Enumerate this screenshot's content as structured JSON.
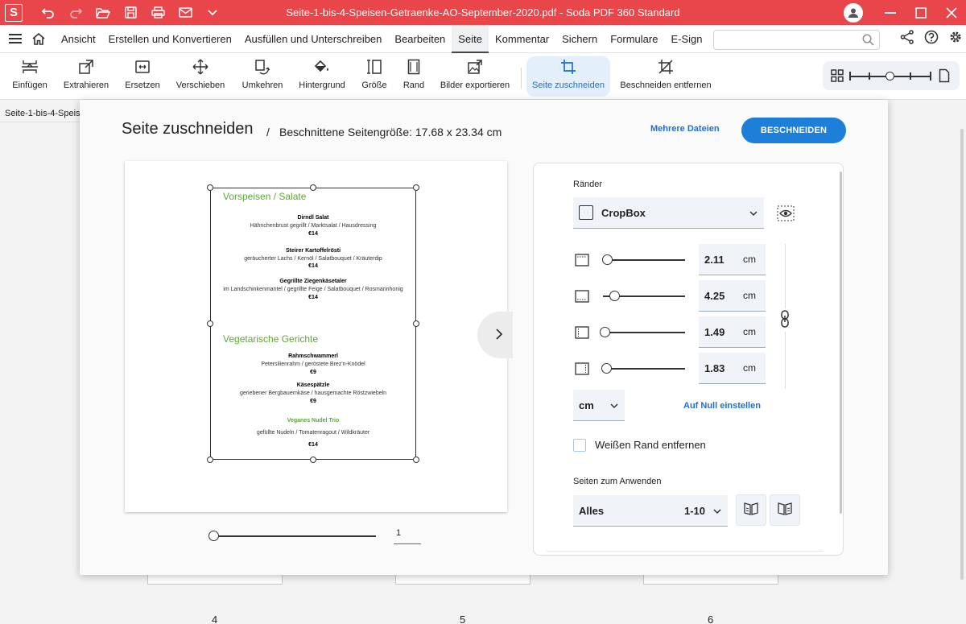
{
  "titlebar": {
    "app_logo": "S",
    "title": "Seite-1-bis-4-Speisen-Getraenke-AO-September-2020.pdf  -  Soda PDF 360 Standard",
    "accent": "#e8464a"
  },
  "menubar": {
    "items": [
      "Ansicht",
      "Erstellen und Konvertieren",
      "Ausfüllen und Unterschreiben",
      "Bearbeiten",
      "Seite",
      "Kommentar",
      "Sichern",
      "Formulare",
      "E-Sign"
    ],
    "active": "Seite",
    "search_placeholder": ""
  },
  "ribbon": {
    "tools": [
      {
        "label": "Einfügen",
        "icon": "insert-icon"
      },
      {
        "label": "Extrahieren",
        "icon": "extract-icon"
      },
      {
        "label": "Ersetzen",
        "icon": "replace-icon"
      },
      {
        "label": "Verschieben",
        "icon": "move-icon"
      },
      {
        "label": "Umkehren",
        "icon": "reverse-icon"
      },
      {
        "label": "Hintergrund",
        "icon": "background-icon"
      },
      {
        "label": "Größe",
        "icon": "size-icon"
      },
      {
        "label": "Rand",
        "icon": "margin-icon"
      },
      {
        "label": "Bilder exportieren",
        "icon": "export-images-icon"
      },
      {
        "label": "Seite zuschneiden",
        "icon": "crop-icon"
      },
      {
        "label": "Beschneiden entfernen",
        "icon": "remove-crop-icon"
      }
    ],
    "active_tool": "Seite zuschneiden"
  },
  "doc_tab": {
    "label": "Seite-1-bis-4-Speis"
  },
  "thumbs": {
    "numbers": [
      "4",
      "5",
      "6"
    ]
  },
  "dialog": {
    "title": "Seite zuschneiden",
    "separator": "/",
    "subtitle": "Beschnittene Seitengröße: 17.68 x 23.34 cm",
    "multi_files_link": "Mehrere Dateien",
    "crop_button": "BESCHNEIDEN",
    "page_number": "1",
    "preview": {
      "sections": [
        {
          "heading": "Vorspeisen / Salate",
          "items": [
            {
              "name": "Dirndl Salat",
              "desc": "Hähnchenbrust gegrillt / Marktsalat / Hausdressing",
              "price": "€14"
            },
            {
              "name": "Steirer Kartoffelrösti",
              "desc": "geräucherter Lachs / Kernöl / Salatbouquet / Kräuterdip",
              "price": "€14"
            },
            {
              "name": "Gegrillte Ziegenkäsetaler",
              "desc": "im Landschinkenmantel / gegrillte Feige / Salatbouquet / Rosmarinhonig",
              "price": "€14"
            }
          ]
        },
        {
          "heading": "Vegetarische Gerichte",
          "items": [
            {
              "name": "Rahmschwammerl",
              "desc": "Petersilienrahm / geröstete Brez'n-Knödel",
              "price": "€9"
            },
            {
              "name": "Käsespätzle",
              "desc": "geriebener Bergbauernkäse / hausgemachte Röstzwiebeln",
              "price": "€9"
            },
            {
              "name": "Veganes Nudel Trio",
              "desc": "gefüllte Nudeln  / Tomatenragout / Wildkräuter",
              "price": "€14"
            }
          ]
        }
      ]
    },
    "panel": {
      "margins_header": "Ränder",
      "box_select": "CropBox",
      "margins": [
        {
          "side": "top",
          "value": "2.11",
          "unit": "cm",
          "fraction": 0.05
        },
        {
          "side": "bottom",
          "value": "4.25",
          "unit": "cm",
          "fraction": 0.14
        },
        {
          "side": "left",
          "value": "1.49",
          "unit": "cm",
          "fraction": 0.02
        },
        {
          "side": "right",
          "value": "1.83",
          "unit": "cm",
          "fraction": 0.04
        }
      ],
      "unit_select": "cm",
      "reset_link": "Auf Null einstellen",
      "remove_white_label": "Weißen Rand entfernen",
      "apply_header": "Seiten zum Anwenden",
      "apply_select": "Alles",
      "apply_range": "1-10"
    }
  }
}
